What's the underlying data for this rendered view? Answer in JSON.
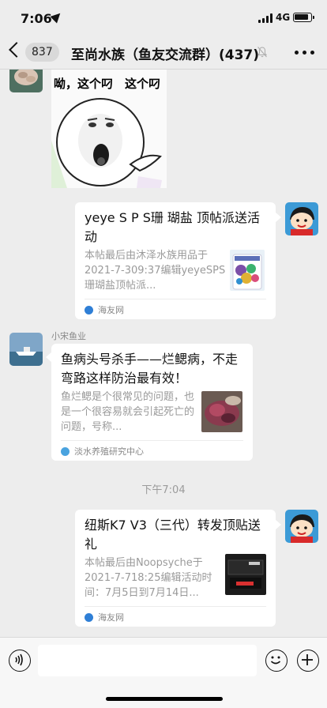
{
  "status_bar": {
    "time": "7:06",
    "network": "4G"
  },
  "nav": {
    "back_count": "837",
    "title": "至尚水族（鱼友交流群）(437)"
  },
  "messages": {
    "sticker": {
      "text": "呦，这个叼　这个叼"
    },
    "card1": {
      "title": "yeye S P S珊 瑚盐 顶帖派送活动",
      "desc": "本帖最后由沐泽水族用品于2021-7-309:37编辑yeyeSPS珊瑚盐顶帖派...",
      "source": "海友网"
    },
    "card2": {
      "sender": "小宋鱼业",
      "title": "鱼病头号杀手——烂鳃病，不走弯路这样防治最有效！",
      "desc": "鱼烂鳃是个很常见的问题，也是一个很容易就会引起死亡的问题，号称...",
      "source": "淡水养殖研究中心"
    },
    "timestamp": "下午7:04",
    "card3": {
      "title": "纽斯K7 V3（三代）转发顶贴送礼",
      "desc": "本帖最后由Noopsyche于2021-7-718:25编辑活动时间：7月5日到7月14日...",
      "source": "海友网"
    }
  },
  "input": {
    "placeholder": ""
  },
  "icons": {
    "back": "chevron-left-icon",
    "mute": "mute-bell-icon",
    "more": "more-dots-icon",
    "voice": "voice-icon",
    "emoji": "emoji-icon",
    "add": "plus-icon"
  },
  "colors": {
    "background": "#ededed",
    "bubble": "#ffffff",
    "meta": "#9a9a9a"
  }
}
